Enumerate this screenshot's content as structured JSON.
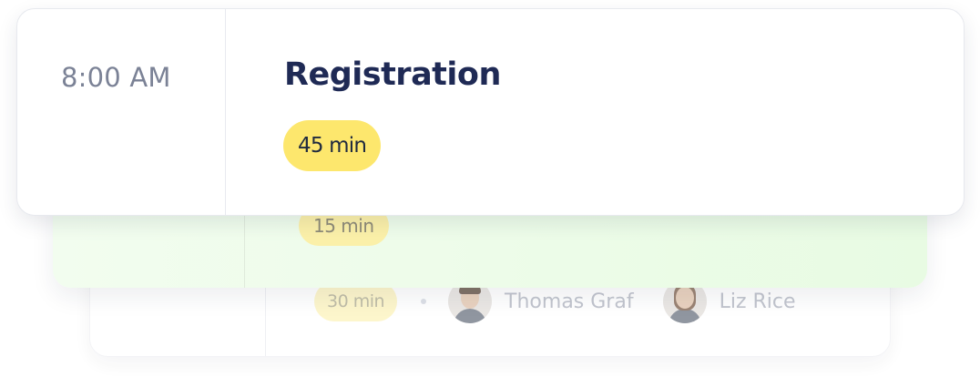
{
  "sessions": [
    {
      "time": "8:00 AM",
      "title": "Registration",
      "duration": "45 min"
    },
    {
      "duration": "15 min"
    },
    {
      "duration": "30 min",
      "speakers": [
        {
          "name": "Thomas Graf"
        },
        {
          "name": "Liz Rice"
        }
      ]
    }
  ],
  "colors": {
    "title": "#1f2a55",
    "time": "#7b8296",
    "duration_pill": "#fde76d",
    "middle_card_bg": "#e8fbe3"
  }
}
